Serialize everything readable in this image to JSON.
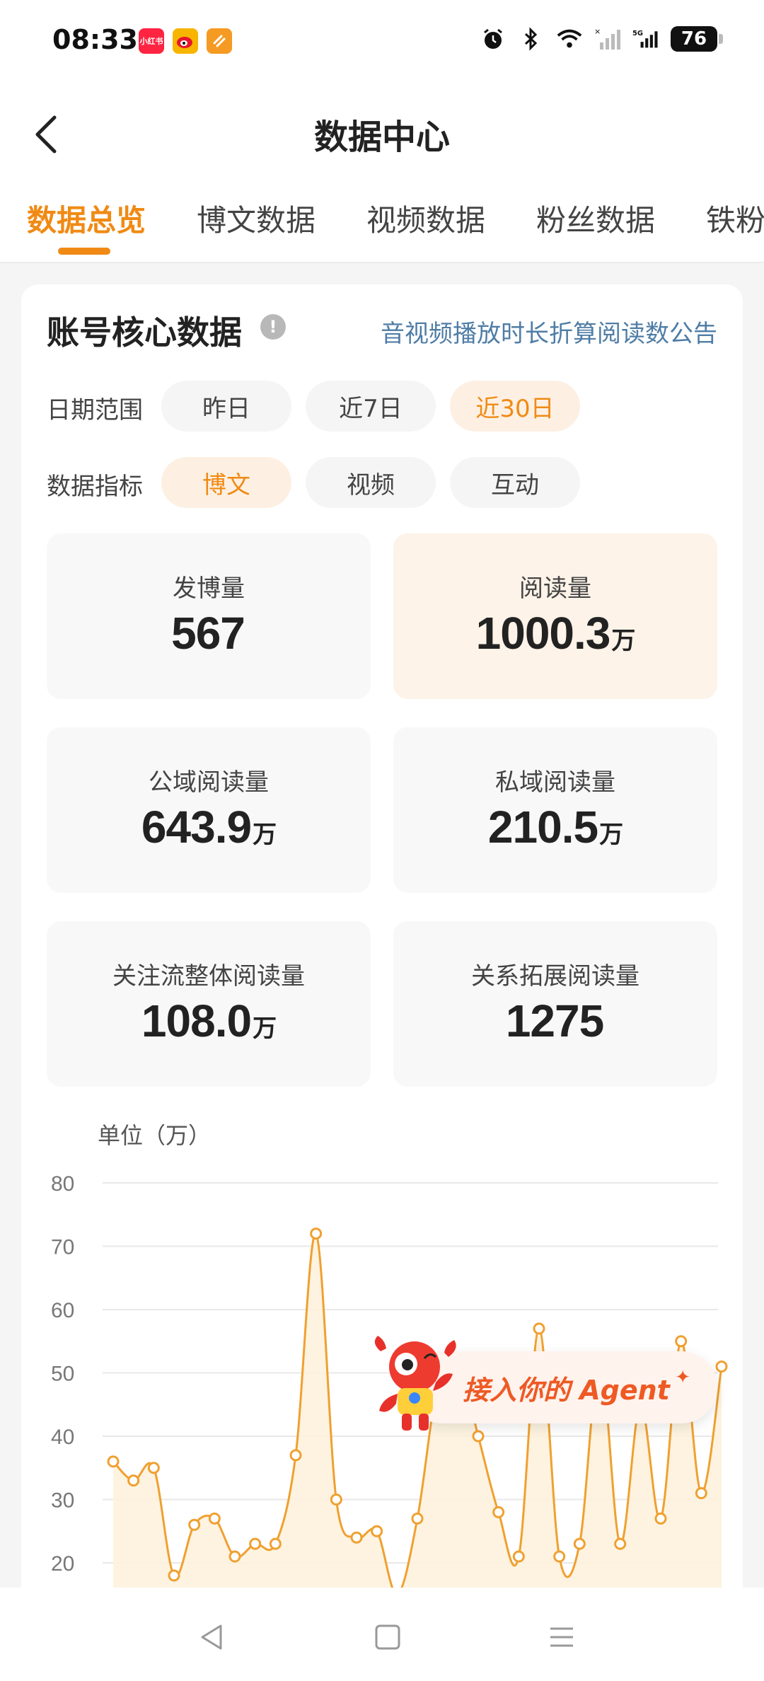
{
  "status_bar": {
    "time": "08:33",
    "apps": [
      {
        "name": "xiaohongshu-icon",
        "label": "小红书",
        "color": "#ff2442"
      },
      {
        "name": "weibo-icon",
        "label": "",
        "color": "#f7b500"
      },
      {
        "name": "app-icon",
        "label": "",
        "color": "#f59a23"
      }
    ],
    "battery": "76"
  },
  "nav": {
    "title": "数据中心"
  },
  "tabs": [
    {
      "label": "数据总览",
      "active": true
    },
    {
      "label": "博文数据",
      "active": false
    },
    {
      "label": "视频数据",
      "active": false
    },
    {
      "label": "粉丝数据",
      "active": false
    },
    {
      "label": "铁粉",
      "active": false
    }
  ],
  "core": {
    "title": "账号核心数据",
    "info": "!",
    "notice_link": "音视频播放时长折算阅读数公告",
    "date_range": {
      "label": "日期范围",
      "options": [
        "昨日",
        "近7日",
        "近30日"
      ],
      "selected": "近30日"
    },
    "metric": {
      "label": "数据指标",
      "options": [
        "博文",
        "视频",
        "互动"
      ],
      "selected": "博文"
    },
    "stats": [
      {
        "label": "发博量",
        "value": "567",
        "unit": ""
      },
      {
        "label": "阅读量",
        "value": "1000.3",
        "unit": "万"
      },
      {
        "label": "公域阅读量",
        "value": "643.9",
        "unit": "万"
      },
      {
        "label": "私域阅读量",
        "value": "210.5",
        "unit": "万"
      },
      {
        "label": "关注流整体阅读量",
        "value": "108.0",
        "unit": "万"
      },
      {
        "label": "关系拓展阅读量",
        "value": "1275",
        "unit": ""
      }
    ]
  },
  "chart_data": {
    "type": "area",
    "ylabel": "单位（万）",
    "ylim": [
      20,
      80
    ],
    "yticks": [
      80,
      70,
      60,
      50,
      40,
      30,
      20
    ],
    "values": [
      36,
      33,
      35,
      18,
      26,
      27,
      21,
      23,
      23,
      37,
      72,
      30,
      24,
      25,
      15,
      27,
      48,
      52,
      40,
      28,
      21,
      57,
      21,
      23,
      52,
      23,
      45,
      27,
      55,
      31,
      51
    ],
    "color": "#f0a030",
    "fill": "#fdf2dd",
    "grid": true
  },
  "agent": {
    "label": "接入你的 Agent",
    "sparkle": "✦"
  }
}
